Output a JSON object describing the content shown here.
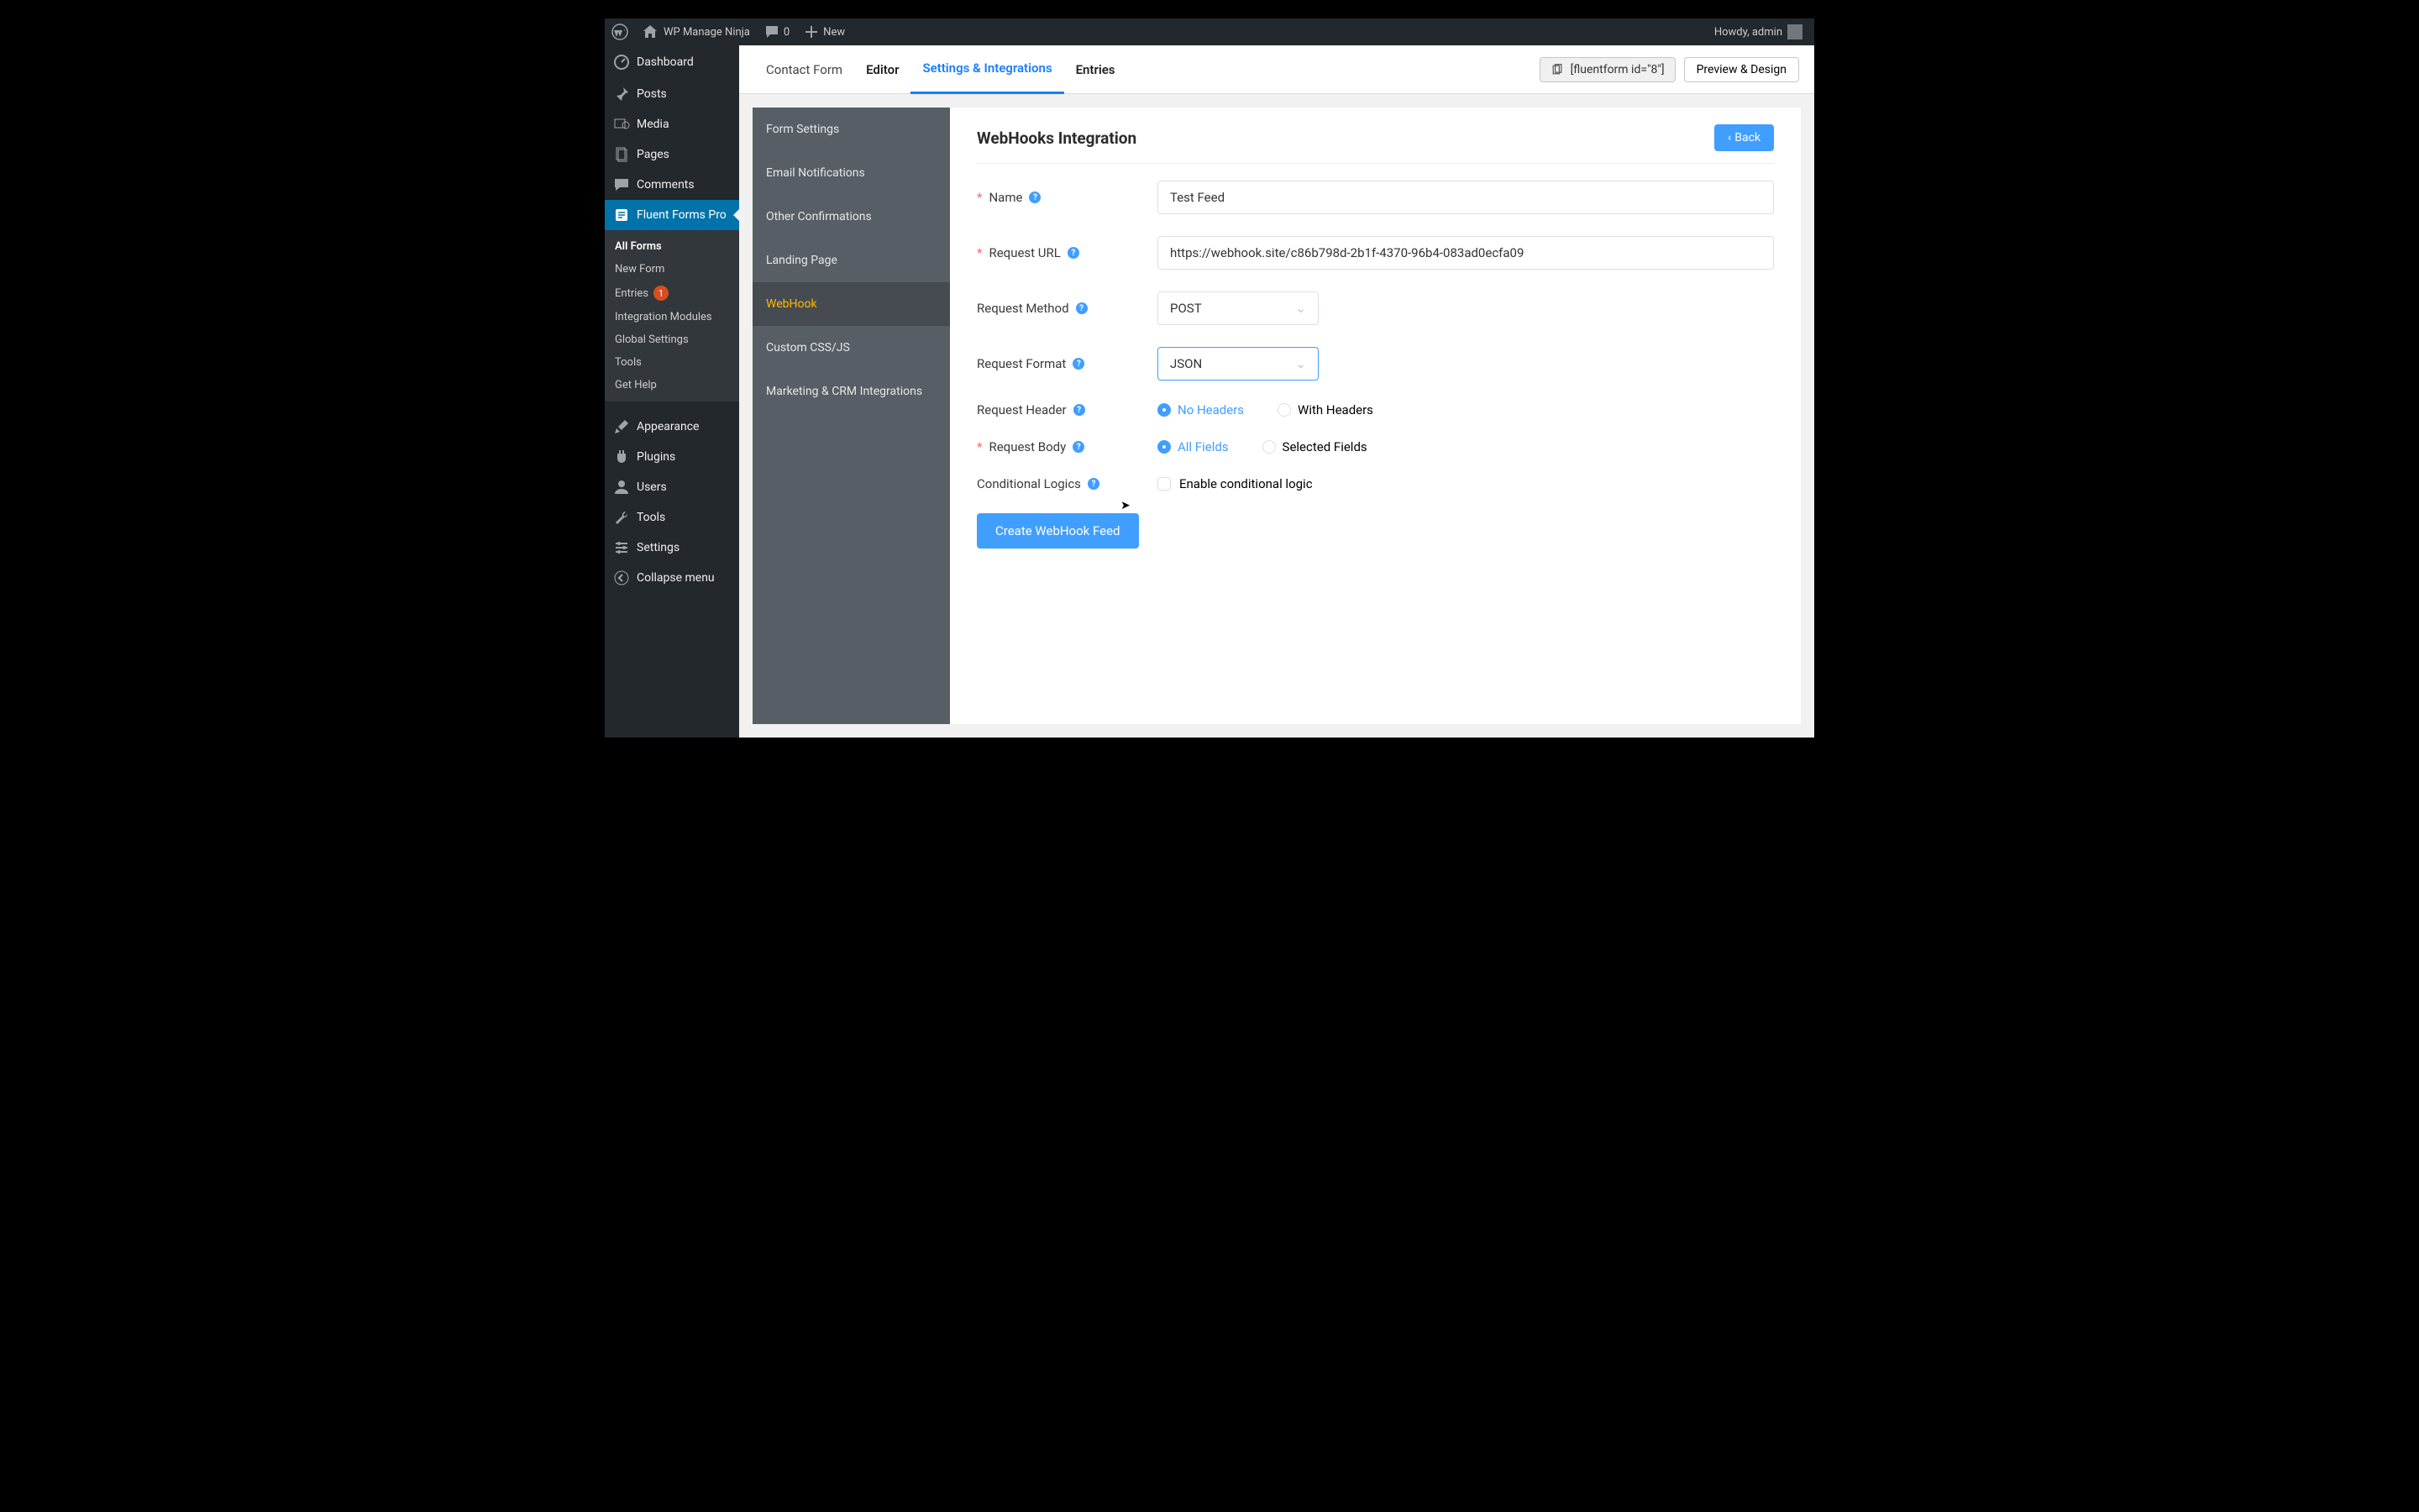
{
  "adminbar": {
    "site_name": "WP Manage Ninja",
    "comments_count": "0",
    "new_label": "New",
    "greeting": "Howdy, admin"
  },
  "sidebar": {
    "dashboard": "Dashboard",
    "posts": "Posts",
    "media": "Media",
    "pages": "Pages",
    "comments": "Comments",
    "fluent_forms": "Fluent Forms Pro",
    "sub": {
      "all_forms": "All Forms",
      "new_form": "New Form",
      "entries": "Entries",
      "entries_badge": "1",
      "integration_modules": "Integration Modules",
      "global_settings": "Global Settings",
      "tools": "Tools",
      "get_help": "Get Help"
    },
    "appearance": "Appearance",
    "plugins": "Plugins",
    "users": "Users",
    "tools": "Tools",
    "settings": "Settings",
    "collapse": "Collapse menu"
  },
  "tabs": {
    "contact_form": "Contact Form",
    "editor": "Editor",
    "settings_integrations": "Settings & Integrations",
    "entries": "Entries",
    "shortcode": "[fluentform id=\"8\"]",
    "preview": "Preview & Design"
  },
  "settings_nav": {
    "form_settings": "Form Settings",
    "email_notifications": "Email Notifications",
    "other_confirmations": "Other Confirmations",
    "landing_page": "Landing Page",
    "webhook": "WebHook",
    "custom_css_js": "Custom CSS/JS",
    "marketing_crm": "Marketing & CRM Integrations"
  },
  "panel": {
    "title": "WebHooks Integration",
    "back": "Back",
    "labels": {
      "name": "Name",
      "request_url": "Request URL",
      "request_method": "Request Method",
      "request_format": "Request Format",
      "request_header": "Request Header",
      "request_body": "Request Body",
      "conditional_logics": "Conditional Logics"
    },
    "values": {
      "name": "Test Feed",
      "request_url": "https://webhook.site/c86b798d-2b1f-4370-96b4-083ad0ecfa09",
      "request_method": "POST",
      "request_format": "JSON"
    },
    "radios": {
      "no_headers": "No Headers",
      "with_headers": "With Headers",
      "all_fields": "All Fields",
      "selected_fields": "Selected Fields"
    },
    "enable_conditional": "Enable conditional logic",
    "submit": "Create WebHook Feed"
  }
}
